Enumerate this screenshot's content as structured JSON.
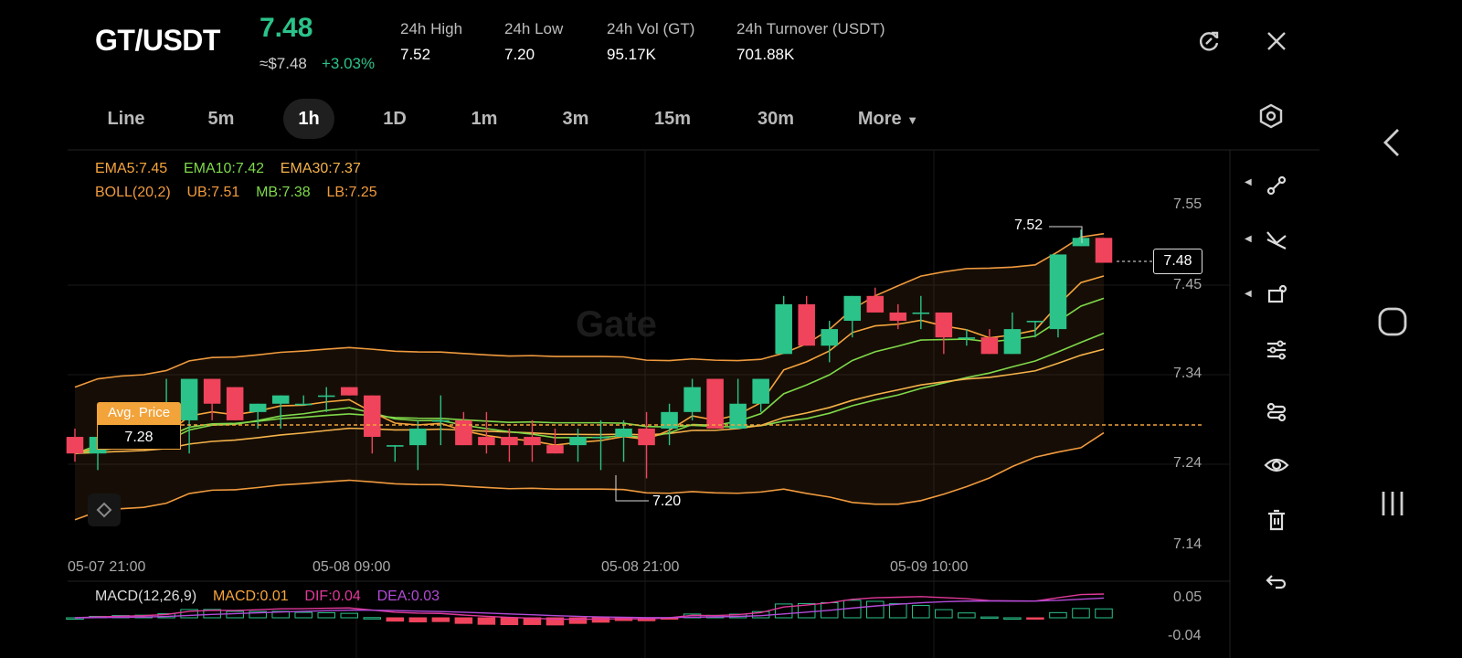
{
  "header": {
    "pair": "GT/USDT",
    "price": "7.48",
    "approx_usd": "≈$7.48",
    "change": "+3.03%",
    "stats": [
      {
        "label": "24h   High",
        "value": "7.52"
      },
      {
        "label": "24h   Low",
        "value": "7.20"
      },
      {
        "label": "24h   Vol (GT)",
        "value": "95.17K"
      },
      {
        "label": "24h   Turnover (USDT)",
        "value": "701.88K"
      }
    ]
  },
  "tabs": [
    {
      "label": "Line",
      "active": false
    },
    {
      "label": "5m",
      "active": false
    },
    {
      "label": "1h",
      "active": true
    },
    {
      "label": "1D",
      "active": false
    },
    {
      "label": "1m",
      "active": false
    },
    {
      "label": "3m",
      "active": false
    },
    {
      "label": "15m",
      "active": false
    },
    {
      "label": "30m",
      "active": false
    },
    {
      "label": "More",
      "active": false
    }
  ],
  "indicators": {
    "ema5": "EMA5:7.45",
    "ema10": "EMA10:7.42",
    "ema30": "EMA30:7.37",
    "boll": "BOLL(20,2)",
    "ub": "UB:7.51",
    "mb": "MB:7.38",
    "lb": "LB:7.25"
  },
  "macd_legend": {
    "name": "MACD(12,26,9)",
    "macd": "MACD:0.01",
    "dif": "DIF:0.04",
    "dea": "DEA:0.03"
  },
  "annotations": {
    "high_marker": "7.52",
    "low_marker": "7.20",
    "avg_price_label": "Avg. Price",
    "avg_price_value": "7.28",
    "last_price": "7.48",
    "watermark": "Gate"
  },
  "colors": {
    "up": "#2bc38a",
    "down": "#f0435c",
    "ema5": "#f7a53c",
    "ema10": "#7fd94a",
    "ema30": "#f5b24a",
    "boll": "#f09a3e",
    "dif": "#e0399a",
    "dea": "#b34bd9"
  },
  "toolbar_icons": [
    "route-icon",
    "crossing-lines-icon",
    "shape-icon",
    "sliders-icon",
    "strategy-icon",
    "eye-icon",
    "trash-icon",
    "undo-icon"
  ],
  "chart_data": {
    "type": "candlestick",
    "interval": "1h",
    "y_ticks": [
      "7.55",
      "7.45",
      "7.34",
      "7.24",
      "7.14"
    ],
    "x_ticks": [
      "05-07 21:00",
      "05-08 09:00",
      "05-08 21:00",
      "05-09 10:00"
    ],
    "macd_ticks": [
      "0.05",
      "-0.04"
    ],
    "ylim": [
      7.13,
      7.57
    ],
    "candles": [
      {
        "o": 7.27,
        "h": 7.28,
        "l": 7.24,
        "c": 7.25
      },
      {
        "o": 7.25,
        "h": 7.28,
        "l": 7.23,
        "c": 7.27
      },
      {
        "o": 7.27,
        "h": 7.27,
        "l": 7.27,
        "c": 7.27
      },
      {
        "o": 7.28,
        "h": 7.29,
        "l": 7.26,
        "c": 7.27
      },
      {
        "o": 7.27,
        "h": 7.34,
        "l": 7.26,
        "c": 7.29
      },
      {
        "o": 7.29,
        "h": 7.34,
        "l": 7.25,
        "c": 7.34
      },
      {
        "o": 7.34,
        "h": 7.34,
        "l": 7.29,
        "c": 7.31
      },
      {
        "o": 7.33,
        "h": 7.33,
        "l": 7.29,
        "c": 7.29
      },
      {
        "o": 7.3,
        "h": 7.31,
        "l": 7.28,
        "c": 7.31
      },
      {
        "o": 7.31,
        "h": 7.32,
        "l": 7.28,
        "c": 7.32
      },
      {
        "o": 7.31,
        "h": 7.32,
        "l": 7.31,
        "c": 7.31
      },
      {
        "o": 7.32,
        "h": 7.33,
        "l": 7.3,
        "c": 7.32
      },
      {
        "o": 7.33,
        "h": 7.33,
        "l": 7.32,
        "c": 7.32
      },
      {
        "o": 7.32,
        "h": 7.32,
        "l": 7.25,
        "c": 7.27
      },
      {
        "o": 7.26,
        "h": 7.26,
        "l": 7.24,
        "c": 7.26
      },
      {
        "o": 7.26,
        "h": 7.29,
        "l": 7.23,
        "c": 7.28
      },
      {
        "o": 7.29,
        "h": 7.32,
        "l": 7.26,
        "c": 7.29
      },
      {
        "o": 7.29,
        "h": 7.3,
        "l": 7.26,
        "c": 7.26
      },
      {
        "o": 7.27,
        "h": 7.3,
        "l": 7.25,
        "c": 7.26
      },
      {
        "o": 7.27,
        "h": 7.28,
        "l": 7.24,
        "c": 7.26
      },
      {
        "o": 7.27,
        "h": 7.29,
        "l": 7.24,
        "c": 7.26
      },
      {
        "o": 7.26,
        "h": 7.28,
        "l": 7.25,
        "c": 7.25
      },
      {
        "o": 7.26,
        "h": 7.28,
        "l": 7.24,
        "c": 7.27
      },
      {
        "o": 7.27,
        "h": 7.29,
        "l": 7.23,
        "c": 7.27
      },
      {
        "o": 7.27,
        "h": 7.29,
        "l": 7.24,
        "c": 7.28
      },
      {
        "o": 7.28,
        "h": 7.3,
        "l": 7.22,
        "c": 7.26
      },
      {
        "o": 7.28,
        "h": 7.31,
        "l": 7.26,
        "c": 7.3
      },
      {
        "o": 7.3,
        "h": 7.34,
        "l": 7.29,
        "c": 7.33
      },
      {
        "o": 7.34,
        "h": 7.34,
        "l": 7.28,
        "c": 7.28
      },
      {
        "o": 7.28,
        "h": 7.34,
        "l": 7.28,
        "c": 7.31
      },
      {
        "o": 7.31,
        "h": 7.34,
        "l": 7.3,
        "c": 7.34
      },
      {
        "o": 7.37,
        "h": 7.44,
        "l": 7.37,
        "c": 7.43
      },
      {
        "o": 7.43,
        "h": 7.44,
        "l": 7.38,
        "c": 7.38
      },
      {
        "o": 7.38,
        "h": 7.41,
        "l": 7.36,
        "c": 7.4
      },
      {
        "o": 7.41,
        "h": 7.44,
        "l": 7.39,
        "c": 7.44
      },
      {
        "o": 7.44,
        "h": 7.45,
        "l": 7.42,
        "c": 7.42
      },
      {
        "o": 7.42,
        "h": 7.43,
        "l": 7.4,
        "c": 7.41
      },
      {
        "o": 7.42,
        "h": 7.44,
        "l": 7.4,
        "c": 7.42
      },
      {
        "o": 7.42,
        "h": 7.42,
        "l": 7.37,
        "c": 7.39
      },
      {
        "o": 7.39,
        "h": 7.4,
        "l": 7.38,
        "c": 7.39
      },
      {
        "o": 7.39,
        "h": 7.4,
        "l": 7.37,
        "c": 7.37
      },
      {
        "o": 7.37,
        "h": 7.42,
        "l": 7.37,
        "c": 7.4
      },
      {
        "o": 7.41,
        "h": 7.41,
        "l": 7.39,
        "c": 7.41
      },
      {
        "o": 7.4,
        "h": 7.49,
        "l": 7.39,
        "c": 7.49
      },
      {
        "o": 7.5,
        "h": 7.52,
        "l": 7.5,
        "c": 7.51
      },
      {
        "o": 7.51,
        "h": 7.51,
        "l": 7.48,
        "c": 7.48
      }
    ]
  }
}
